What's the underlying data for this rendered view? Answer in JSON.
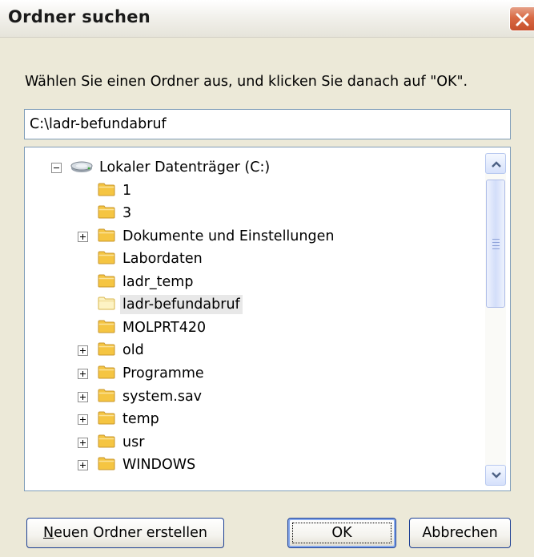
{
  "window": {
    "title": "Ordner suchen",
    "close_icon": "close-icon"
  },
  "instruction": "Wählen Sie einen Ordner aus, und klicken Sie danach auf \"OK\".",
  "path_field": {
    "value": "C:\\ladr-befundabruf"
  },
  "tree": {
    "root": {
      "label": "Lokaler Datenträger (C:)",
      "icon": "drive-icon",
      "expanded": true
    },
    "items": [
      {
        "label": "1",
        "expandable": false,
        "selected": false
      },
      {
        "label": "3",
        "expandable": false,
        "selected": false
      },
      {
        "label": "Dokumente und Einstellungen",
        "expandable": true,
        "selected": false
      },
      {
        "label": "Labordaten",
        "expandable": false,
        "selected": false
      },
      {
        "label": "ladr_temp",
        "expandable": false,
        "selected": false
      },
      {
        "label": "ladr-befundabruf",
        "expandable": false,
        "selected": true
      },
      {
        "label": "MOLPRT420",
        "expandable": false,
        "selected": false
      },
      {
        "label": "old",
        "expandable": true,
        "selected": false
      },
      {
        "label": "Programme",
        "expandable": true,
        "selected": false
      },
      {
        "label": "system.sav",
        "expandable": true,
        "selected": false
      },
      {
        "label": "temp",
        "expandable": true,
        "selected": false
      },
      {
        "label": "usr",
        "expandable": true,
        "selected": false
      },
      {
        "label": "WINDOWS",
        "expandable": true,
        "selected": false
      }
    ]
  },
  "buttons": {
    "new_folder_mnemonic": "N",
    "new_folder_rest": "euen Ordner erstellen",
    "ok": "OK",
    "cancel": "Abbrechen"
  },
  "colors": {
    "dialog_bg": "#ece9d8",
    "field_border": "#7f9db9",
    "close_button": "#d96a44",
    "folder": "#f5c542",
    "selected_highlight": "#e8e8e8"
  }
}
